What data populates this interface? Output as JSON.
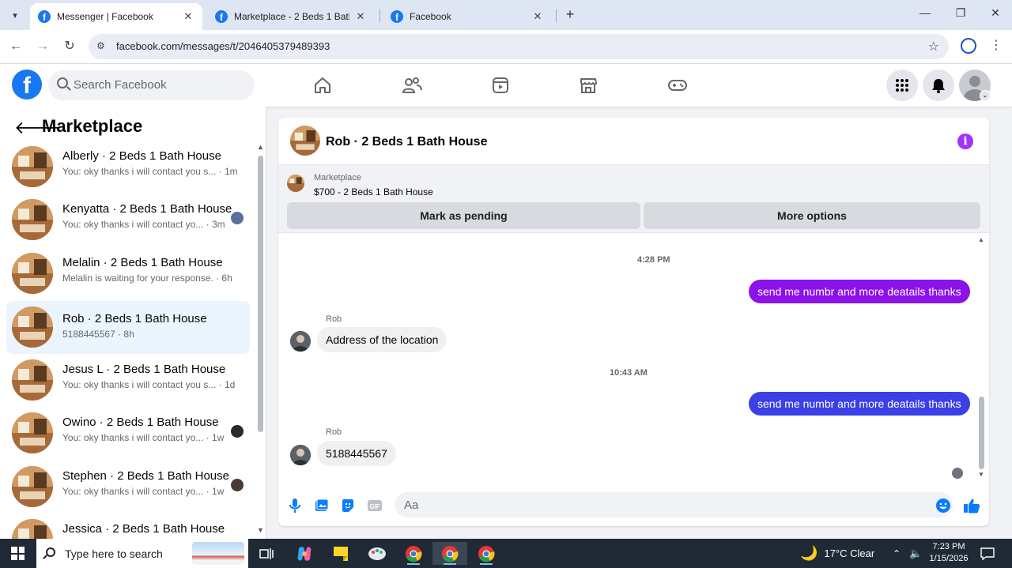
{
  "browser": {
    "tabs": [
      {
        "title": "Messenger | Facebook",
        "active": true
      },
      {
        "title": "Marketplace - 2 Beds 1 Bath Ho",
        "active": false
      },
      {
        "title": "Facebook",
        "active": false
      }
    ],
    "url": "facebook.com/messages/t/2046405379489393"
  },
  "topbar": {
    "search_placeholder": "Search Facebook"
  },
  "sidebar": {
    "title": "Marketplace",
    "conversations": [
      {
        "name": "Alberly · 2 Beds 1 Bath House",
        "snippet": "You: oky thanks i will contact you s... · 1m"
      },
      {
        "name": "Kenyatta · 2 Beds 1 Bath House",
        "snippet": "You: oky thanks i will contact yo... · 3m"
      },
      {
        "name": "Melalin · 2 Beds 1 Bath House",
        "snippet": "Melalin is waiting for your response. · 6h"
      },
      {
        "name": "Rob · 2 Beds 1 Bath House",
        "snippet": "5188445567 · 8h"
      },
      {
        "name": "Jesus L · 2 Beds 1 Bath House",
        "snippet": "You: oky thanks i will contact you s... · 1d"
      },
      {
        "name": "Owino · 2 Beds 1 Bath House",
        "snippet": "You: oky thanks i will contact yo... · 1w"
      },
      {
        "name": "Stephen · 2 Beds 1 Bath House",
        "snippet": "You: oky thanks i will contact yo... · 1w"
      },
      {
        "name": "Jessica · 2 Beds 1 Bath House",
        "snippet": ""
      }
    ]
  },
  "chat": {
    "title": "Rob · 2 Beds 1 Bath House",
    "listing": {
      "label": "Marketplace",
      "price_title": "$700 - 2 Beds 1 Bath House"
    },
    "buttons": {
      "pending": "Mark as pending",
      "more": "More options"
    },
    "messages": {
      "ts1": "4:28 PM",
      "out1": "send me numbr and more deatails thanks",
      "sender1": "Rob",
      "in1": "Address of the location",
      "ts2": "10:43 AM",
      "out2": "send me numbr and more deatails thanks",
      "sender2": "Rob",
      "in2": "5188445567"
    },
    "composer_placeholder": "Aa",
    "colors": {
      "out1": "#8b12e8",
      "out2": "#3b3fe6",
      "accent": "#a033ff"
    }
  },
  "taskbar": {
    "search_placeholder": "Type here to search",
    "weather": "17°C  Clear",
    "time": "7:23 PM",
    "date": "1/15/2026"
  }
}
